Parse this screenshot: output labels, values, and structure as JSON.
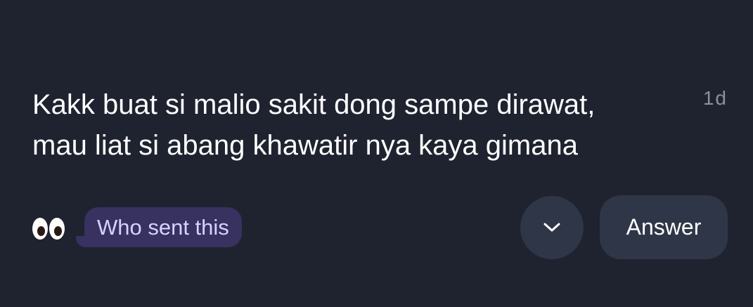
{
  "message": {
    "line1": "Kakk buat si malio sakit dong sampe dirawat,",
    "line2": "mau liat si abang khawatir nya kaya gimana",
    "timestamp": "1d"
  },
  "actions": {
    "reaction_icon": "eyes-emoji-icon",
    "who_sent_label": "Who sent this",
    "expand_icon": "chevron-down-icon",
    "answer_label": "Answer"
  },
  "colors": {
    "background": "#1f2330",
    "who_sent_bubble": "#37325f",
    "who_sent_text": "#d7d2ff",
    "button_bg": "#2f3647",
    "timestamp": "#8b90a0"
  }
}
